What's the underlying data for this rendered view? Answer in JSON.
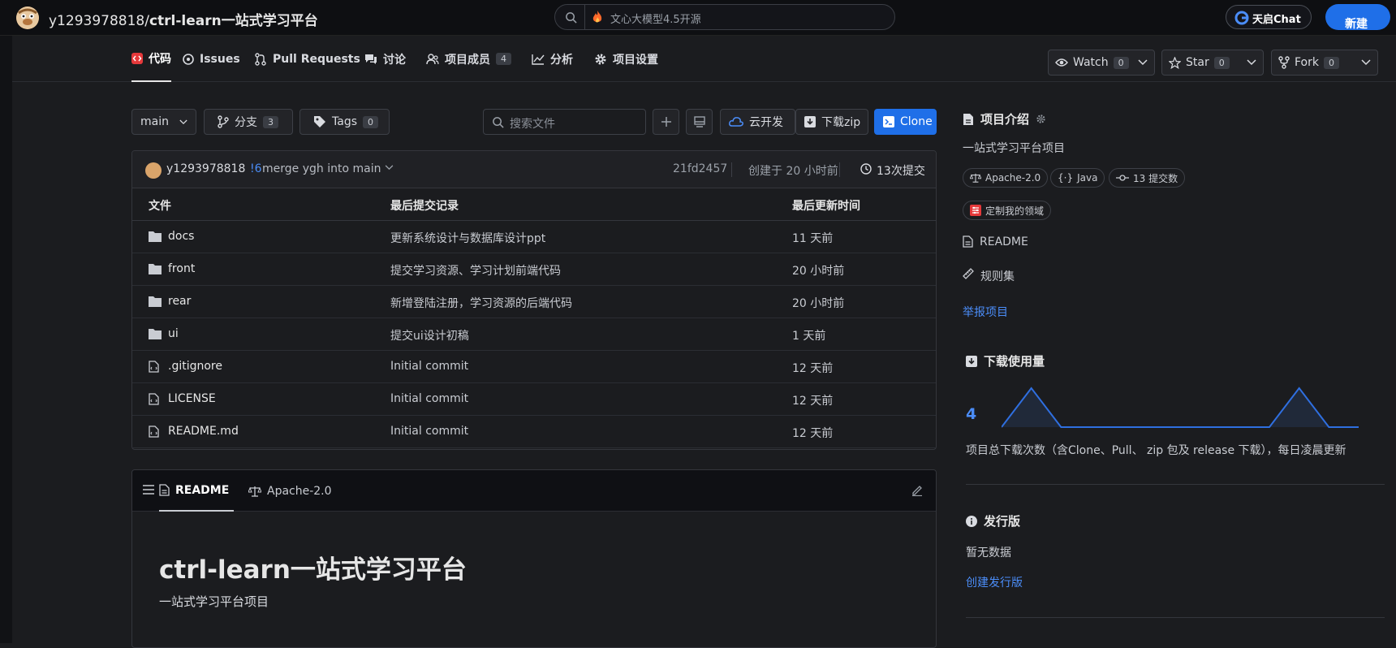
{
  "header": {
    "owner": "y1293978818/",
    "repo": "ctrl-learn一站式学习平台",
    "search_placeholder": "文心大模型4.5开源",
    "tianqi_label": "天启Chat",
    "new_label": "新建"
  },
  "nav": {
    "tabs": [
      {
        "label": "代码"
      },
      {
        "label": "Issues"
      },
      {
        "label": "Pull Requests"
      },
      {
        "label": "讨论"
      },
      {
        "label": "项目成员",
        "count": "4"
      },
      {
        "label": "分析"
      },
      {
        "label": "项目设置"
      }
    ],
    "watch": {
      "label": "Watch",
      "count": "0"
    },
    "star": {
      "label": "Star",
      "count": "0"
    },
    "fork": {
      "label": "Fork",
      "count": "0"
    }
  },
  "toolbar": {
    "branch": "main",
    "branches_label": "分支",
    "branches_count": "3",
    "tags_label": "Tags",
    "tags_count": "0",
    "file_search_placeholder": "搜索文件",
    "cloud_label": "云开发",
    "zip_label": "下载zip",
    "clone_label": "Clone"
  },
  "commit": {
    "author": "y1293978818",
    "pr": "!6",
    "message": " merge ygh into main",
    "hash": "21fd2457",
    "created": "创建于 20 小时前",
    "commits": "13次提交"
  },
  "table": {
    "headers": {
      "file": "文件",
      "last_commit": "最后提交记录",
      "updated": "最后更新时间"
    },
    "rows": [
      {
        "type": "folder",
        "name": "docs",
        "message": "更新系统设计与数据库设计ppt",
        "time": "11 天前"
      },
      {
        "type": "folder",
        "name": "front",
        "message": "提交学习资源、学习计划前端代码",
        "time": "20 小时前"
      },
      {
        "type": "folder",
        "name": "rear",
        "message": "新增登陆注册，学习资源的后端代码",
        "time": "20 小时前"
      },
      {
        "type": "folder",
        "name": "ui",
        "message": "提交ui设计初稿",
        "time": "1 天前"
      },
      {
        "type": "file",
        "name": ".gitignore",
        "message": "Initial commit",
        "time": "12 天前"
      },
      {
        "type": "file",
        "name": "LICENSE",
        "message": "Initial commit",
        "time": "12 天前"
      },
      {
        "type": "file",
        "name": "README.md",
        "message": "Initial commit",
        "time": "12 天前"
      }
    ]
  },
  "readme": {
    "tab_readme": "README",
    "tab_license": "Apache-2.0",
    "heading": "ctrl-learn一站式学习平台",
    "body": "一站式学习平台项目"
  },
  "sidebar": {
    "intro_title": "项目介绍",
    "intro_text": "一站式学习平台项目",
    "chip_license": "Apache-2.0",
    "chip_lang": "Java",
    "chip_commits": "13 提交数",
    "chip_custom": "定制我的领域",
    "readme_link": "README",
    "rules_link": "规则集",
    "report_link": "举报项目",
    "downloads_title": "下载使用量",
    "downloads_count": "4",
    "downloads_note": "项目总下载次数（含Clone、Pull、 zip 包及 release 下载），每日凌晨更新",
    "release_title": "发行版",
    "release_empty": "暂无数据",
    "release_create": "创建发行版"
  },
  "downloads_sparkline": [
    0,
    2,
    0,
    0,
    0,
    0,
    0,
    0,
    0,
    0,
    2,
    0,
    0
  ],
  "colors": {
    "accent": "#1f6fe8",
    "link": "#4b8df8",
    "bg": "#1b1c1f"
  }
}
